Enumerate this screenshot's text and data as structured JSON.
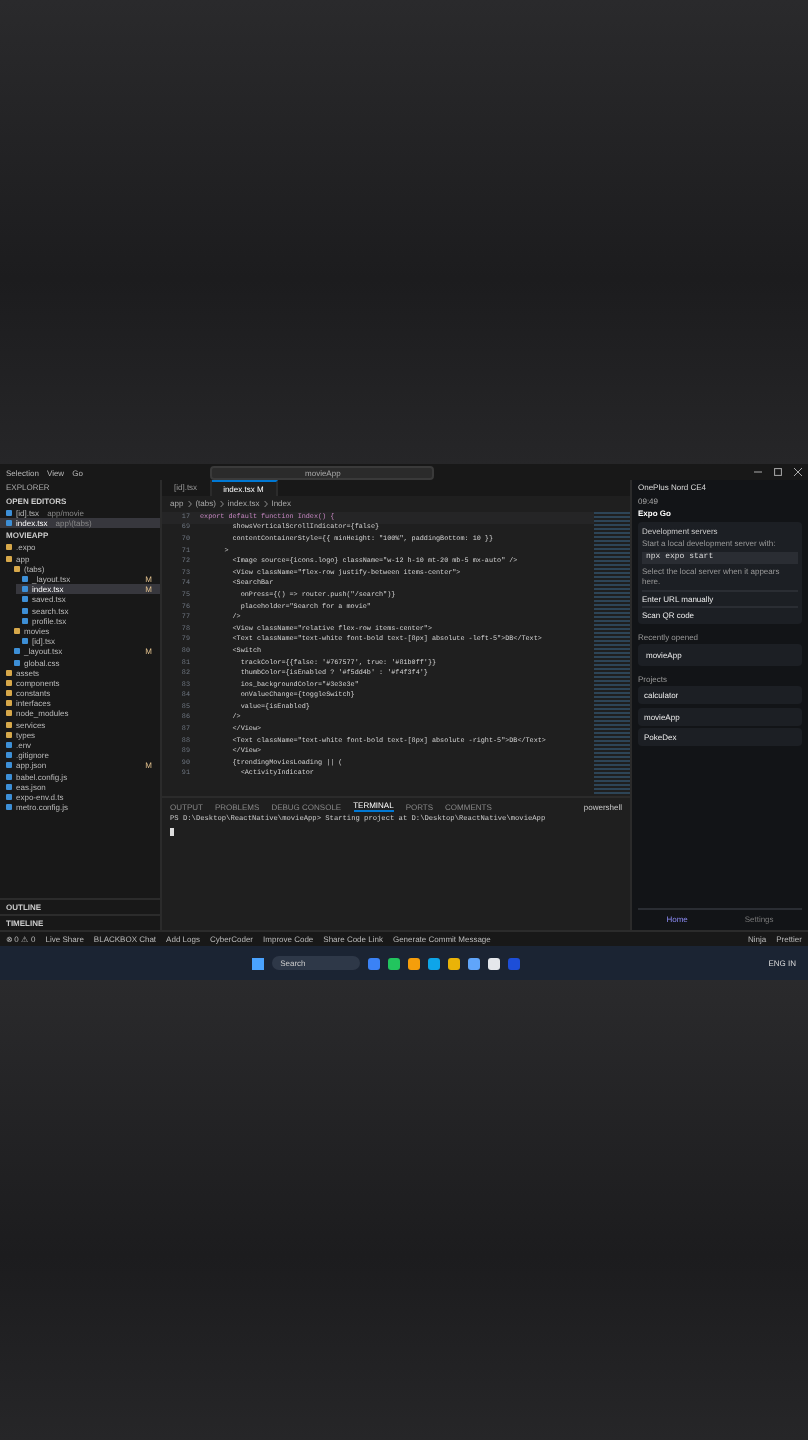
{
  "title_bar": {
    "menu": [
      "Selection",
      "View",
      "Go"
    ],
    "search": "movieApp"
  },
  "explorer": {
    "title": "EXPLORER",
    "open_editors": {
      "label": "OPEN EDITORS",
      "items": [
        {
          "name": "[id].tsx",
          "path": "app/movie",
          "selected": false
        },
        {
          "name": "index.tsx",
          "path": "app\\(tabs)",
          "selected": true
        }
      ]
    },
    "project": "MOVIEAPP",
    "tree": [
      {
        "name": ".expo",
        "kind": "folder",
        "selected": false
      },
      {
        "name": "app",
        "kind": "folder",
        "selected": false,
        "children": [
          {
            "name": "(tabs)",
            "kind": "folder",
            "selected": false,
            "children": [
              {
                "name": "_layout.tsx",
                "kind": "file",
                "badge": "M",
                "selected": false
              },
              {
                "name": "index.tsx",
                "kind": "file",
                "badge": "M",
                "selected": true
              },
              {
                "name": "saved.tsx",
                "kind": "file",
                "selected": false
              },
              {
                "name": "search.tsx",
                "kind": "file",
                "selected": false
              },
              {
                "name": "profile.tsx",
                "kind": "file",
                "selected": false
              }
            ]
          },
          {
            "name": "movies",
            "kind": "folder",
            "selected": false,
            "children": [
              {
                "name": "[id].tsx",
                "kind": "file",
                "selected": false
              }
            ]
          },
          {
            "name": "_layout.tsx",
            "kind": "file",
            "badge": "M",
            "selected": false
          },
          {
            "name": "global.css",
            "kind": "file",
            "selected": false
          }
        ]
      },
      {
        "name": "assets",
        "kind": "folder",
        "selected": false
      },
      {
        "name": "components",
        "kind": "folder",
        "selected": false
      },
      {
        "name": "constants",
        "kind": "folder",
        "selected": false
      },
      {
        "name": "interfaces",
        "kind": "folder",
        "selected": false
      },
      {
        "name": "node_modules",
        "kind": "folder",
        "selected": false
      },
      {
        "name": "services",
        "kind": "folder",
        "selected": false
      },
      {
        "name": "types",
        "kind": "folder",
        "selected": false
      },
      {
        "name": ".env",
        "kind": "file",
        "selected": false
      },
      {
        "name": ".gitignore",
        "kind": "file",
        "selected": false
      },
      {
        "name": "app.json",
        "kind": "file",
        "badge": "M",
        "selected": false
      },
      {
        "name": "babel.config.js",
        "kind": "file",
        "selected": false
      },
      {
        "name": "eas.json",
        "kind": "file",
        "selected": false
      },
      {
        "name": "expo-env.d.ts",
        "kind": "file",
        "selected": false
      },
      {
        "name": "metro.config.js",
        "kind": "file",
        "selected": false
      }
    ],
    "sections": [
      "OUTLINE",
      "TIMELINE"
    ]
  },
  "editor": {
    "tabs": [
      {
        "label": "[id].tsx",
        "selected": false
      },
      {
        "label": "index.tsx M",
        "selected": true
      }
    ],
    "breadcrumb": [
      "app",
      "(tabs)",
      "index.tsx",
      "Index"
    ],
    "sticky": {
      "number": "17",
      "text": "export default function Index() {"
    },
    "lines": [
      {
        "number": "69",
        "text": "        showsVerticalScrollIndicator={false}"
      },
      {
        "number": "70",
        "text": "        contentContainerStyle={{ minHeight: \"100%\", paddingBottom: 10 }}"
      },
      {
        "number": "71",
        "text": "      >"
      },
      {
        "number": "72",
        "text": "        <Image source={icons.logo} className=\"w-12 h-10 mt-20 mb-5 mx-auto\" />"
      },
      {
        "number": "73",
        "text": "        <View className=\"flex-row justify-between items-center\">"
      },
      {
        "number": "74",
        "text": "        <SearchBar"
      },
      {
        "number": "75",
        "text": "          onPress={() => router.push(\"/search\")}"
      },
      {
        "number": "76",
        "text": "          placeholder=\"Search for a movie\""
      },
      {
        "number": "77",
        "text": "        />"
      },
      {
        "number": "78",
        "text": "        <View className=\"relative flex-row items-center\">"
      },
      {
        "number": "79",
        "text": "        <Text className=\"text-white font-bold text-[8px] absolute -left-5\">DB</Text>"
      },
      {
        "number": "80",
        "text": "        <Switch"
      },
      {
        "number": "81",
        "text": "          trackColor={{false: '#767577', true: '#81b0ff'}}"
      },
      {
        "number": "82",
        "text": "          thumbColor={isEnabled ? '#f5dd4b' : '#f4f3f4'}"
      },
      {
        "number": "83",
        "text": "          ios_backgroundColor=\"#3e3e3e\""
      },
      {
        "number": "84",
        "text": "          onValueChange={toggleSwitch}"
      },
      {
        "number": "85",
        "text": "          value={isEnabled}"
      },
      {
        "number": "86",
        "text": "        />"
      },
      {
        "number": "87",
        "text": "        </View>"
      },
      {
        "number": "88",
        "text": "        <Text className=\"text-white font-bold text-[8px] absolute -right-5\">DB</Text>"
      },
      {
        "number": "89",
        "text": "        </View>"
      },
      {
        "number": "90",
        "text": "        {trendingMoviesLoading || ("
      },
      {
        "number": "91",
        "text": "          <ActivityIndicator"
      }
    ]
  },
  "panel": {
    "tabs": [
      {
        "label": "OUTPUT",
        "selected": false
      },
      {
        "label": "PROBLEMS",
        "selected": false
      },
      {
        "label": "DEBUG CONSOLE",
        "selected": false
      },
      {
        "label": "TERMINAL",
        "selected": true
      },
      {
        "label": "PORTS",
        "selected": false
      },
      {
        "label": "COMMENTS",
        "selected": false
      }
    ],
    "shell": "powershell",
    "output": "PS D:\\Desktop\\ReactNative\\movieApp> Starting project at D:\\Desktop\\ReactNative\\movieApp"
  },
  "status_bar": {
    "left": [
      "⊗ 0 ⚠ 0",
      "Live Share",
      "BLACKBOX Chat",
      "Add Logs",
      "CyberCoder",
      "Improve Code",
      "Share Code Link",
      "Generate Commit Message"
    ],
    "right": [
      "Ninja",
      "Prettier"
    ]
  },
  "phone": {
    "title": "OnePlus Nord CE4",
    "time": "09:49",
    "app": "Expo Go",
    "dev_title": "Development servers",
    "dev_hint": "Start a local development server with:",
    "command": "npx expo start",
    "dev_note": "Select the local server when it appears here.",
    "actions": [
      "Enter URL manually",
      "Scan QR code"
    ],
    "recent_title": "Recently opened",
    "recent": [
      "movieApp"
    ],
    "projects_title": "Projects",
    "projects": [
      "calculator",
      "movieApp",
      "PokeDex"
    ],
    "nav": [
      {
        "label": "Home",
        "selected": true
      },
      {
        "label": "Settings",
        "selected": false
      }
    ]
  },
  "taskbar": {
    "search": "Search",
    "lang": "ENG IN"
  }
}
